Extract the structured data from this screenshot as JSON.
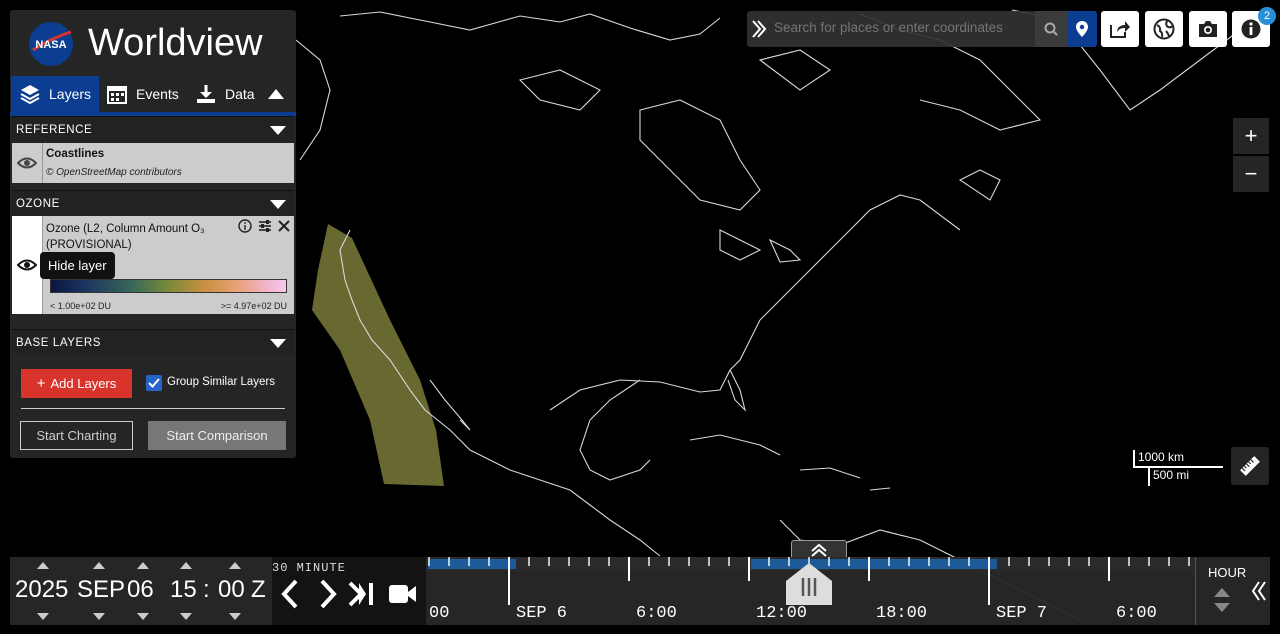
{
  "app": {
    "brand_name": "Worldview",
    "logo_text": "NASA"
  },
  "tabs": [
    {
      "label": "Layers",
      "icon": "layers-icon",
      "active": true
    },
    {
      "label": "Events",
      "icon": "calendar-icon"
    },
    {
      "label": "Data",
      "icon": "download-icon"
    }
  ],
  "categories": {
    "reference": "REFERENCE",
    "ozone": "OZONE",
    "base_layers": "BASE LAYERS"
  },
  "layers": {
    "coastlines": {
      "name": "Coastlines",
      "attribution": "© OpenStreetMap contributors"
    },
    "ozone": {
      "name_line1": "Ozone (L2, Column Amount O₃",
      "name_line2": "(PROVISIONAL)",
      "colorbar_min": "< 1.00e+02 DU",
      "colorbar_max": ">= 4.97e+02 DU"
    }
  },
  "tooltip": "Hide layer",
  "actions": {
    "add_layers": "Add Layers",
    "group_similar": "Group Similar Layers",
    "group_similar_checked": true,
    "start_charting": "Start Charting",
    "start_comparison": "Start Comparison"
  },
  "search": {
    "placeholder": "Search for places or enter coordinates"
  },
  "info_badge_count": "2",
  "zoom": {
    "in": "+",
    "out": "−"
  },
  "scale": {
    "km": "1000 km",
    "mi": "500 mi"
  },
  "timeline": {
    "year": "2025",
    "month": "SEP",
    "day": "06",
    "hour": "15",
    "separator": ":",
    "minute": "00",
    "zone": "Z",
    "interval": "30 MINUTE",
    "zoom_level": "HOUR",
    "tick_labels": [
      "00",
      "SEP 6",
      "6:00",
      "12:00",
      "18:00",
      "SEP 7",
      "6:00"
    ]
  },
  "colors": {
    "accent": "#0b3d91",
    "add_layers": "#d9342b",
    "checkbox": "#2563c9",
    "badge": "#2a8fd9"
  }
}
